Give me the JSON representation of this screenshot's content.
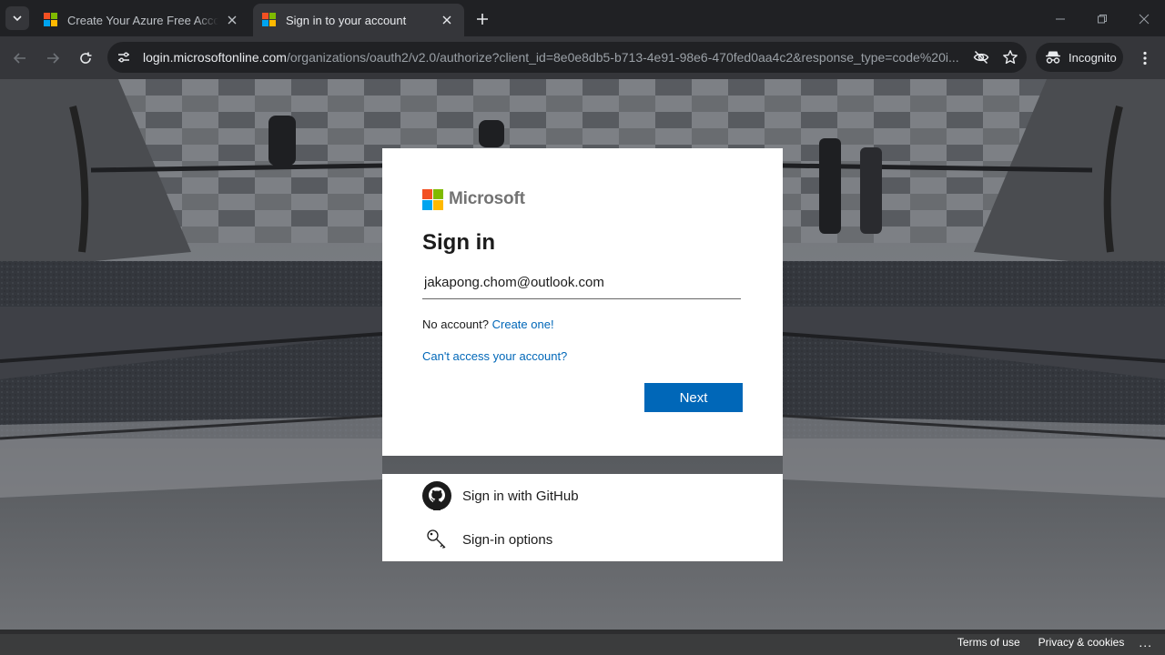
{
  "browser": {
    "tabs": [
      {
        "title": "Create Your Azure Free Account",
        "active": false
      },
      {
        "title": "Sign in to your account",
        "active": true
      }
    ],
    "url_host": "login.microsoftonline.com",
    "url_path": "/organizations/oauth2/v2.0/authorize?client_id=8e0e8db5-b713-4e91-98e6-470fed0aa4c2&response_type=code%20i...",
    "incognito_label": "Incognito"
  },
  "colors": {
    "ms_red": "#f25022",
    "ms_green": "#7fba00",
    "ms_blue": "#00a4ef",
    "ms_yellow": "#ffb900",
    "link": "#0067b8",
    "primary_button": "#0067b8"
  },
  "signin": {
    "brand": "Microsoft",
    "heading": "Sign in",
    "email_value": "jakapong.chom@outlook.com",
    "no_account_text": "No account?",
    "create_link": "Create one!",
    "cant_access_link": "Can't access your account?",
    "next_button": "Next"
  },
  "options": {
    "github_label": "Sign in with GitHub",
    "github_icon": "github-icon",
    "signin_options_label": "Sign-in options",
    "signin_options_icon": "key-icon"
  },
  "footer": {
    "terms": "Terms of use",
    "privacy": "Privacy & cookies",
    "more": "..."
  }
}
